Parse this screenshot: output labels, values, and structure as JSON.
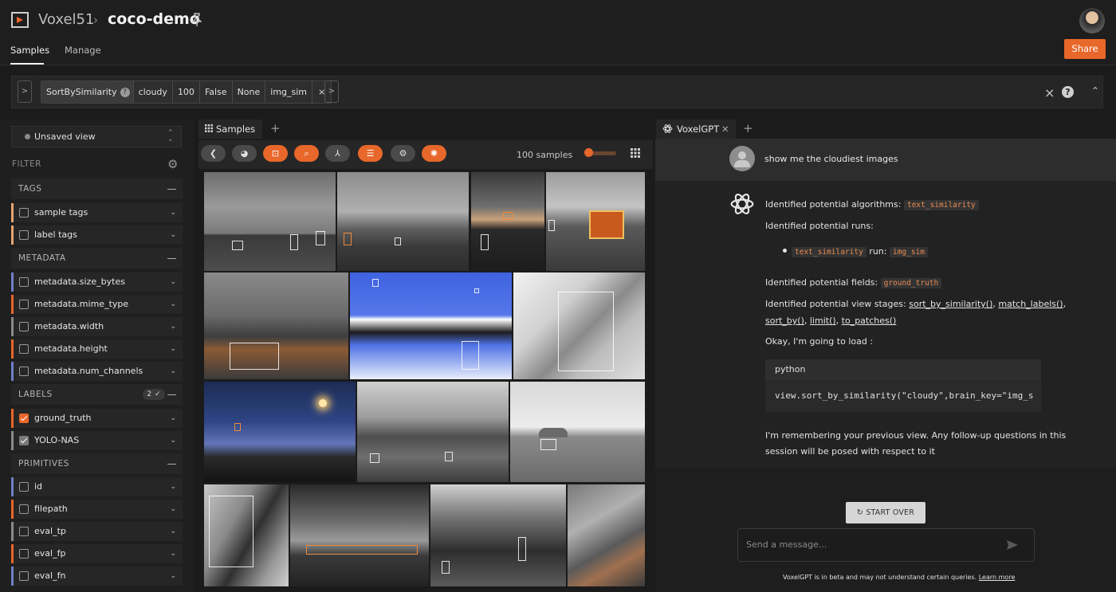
{
  "header": {
    "brand": "Voxel51",
    "separator": "›",
    "dataset": "coco-demo",
    "nav_tabs": [
      "Samples",
      "Manage"
    ],
    "share_label": "Share"
  },
  "viewbar": {
    "left_chevron": ">",
    "right_chevron": ">",
    "stage": {
      "name": "SortBySimilarity",
      "help": "?",
      "params": [
        "cloudy",
        "100",
        "False",
        "None",
        "img_sim"
      ],
      "remove": "×"
    },
    "close": "×",
    "help": "?",
    "collapse": "⌃"
  },
  "sidebar": {
    "view_selector": "Unsaved view",
    "filter_label": "FILTER",
    "groups": [
      {
        "label": "TAGS",
        "collapse": "—"
      },
      {
        "label": "METADATA",
        "collapse": "—"
      },
      {
        "label": "LABELS",
        "collapse": "—",
        "badge": "2 ✓"
      },
      {
        "label": "PRIMITIVES",
        "collapse": "—"
      }
    ],
    "fields": [
      {
        "label": "sample tags",
        "color": "#e8a572"
      },
      {
        "label": "label tags",
        "color": "#e8a572"
      },
      {
        "label": "metadata.size_bytes",
        "color": "#6f7fc9"
      },
      {
        "label": "metadata.mime_type",
        "color": "#e8672a"
      },
      {
        "label": "metadata.width",
        "color": "#8a8a8a"
      },
      {
        "label": "metadata.height",
        "color": "#e8672a"
      },
      {
        "label": "metadata.num_channels",
        "color": "#6f7fc9"
      },
      {
        "label": "ground_truth",
        "color": "#e8672a"
      },
      {
        "label": "YOLO-NAS",
        "color": "#8a8a8a"
      },
      {
        "label": "id",
        "color": "#6f7fc9"
      },
      {
        "label": "filepath",
        "color": "#e8672a"
      },
      {
        "label": "eval_tp",
        "color": "#8a8a8a"
      },
      {
        "label": "eval_fp",
        "color": "#e8672a"
      },
      {
        "label": "eval_fn",
        "color": "#6f7fc9"
      }
    ]
  },
  "samples": {
    "tab_label": "Samples",
    "add_tab": "+",
    "count": "100 samples"
  },
  "voxelgpt": {
    "tab_label": "VoxelGPT",
    "tab_close": "✕",
    "add_tab": "+",
    "user_message": "show me the cloudiest images",
    "algorithms_prefix": "Identified potential algorithms:",
    "algorithms_code": "text_similarity",
    "runs_label": "Identified potential runs:",
    "run_code": "text_similarity",
    "run_word": "run:",
    "run_value": "img_sim",
    "fields_prefix": "Identified potential fields:",
    "fields_code": "ground_truth",
    "stages_prefix": "Identified potential view stages:",
    "stage_links": [
      "sort_by_similarity()",
      "match_labels()",
      "sort_by()",
      "limit()",
      "to_patches()"
    ],
    "loading_text": "Okay, I'm going to load :",
    "code_lang": "python",
    "code_line": "view.sort_by_similarity(\"cloudy\",brain_key=\"img_s",
    "remember_line1": "I'm remembering your previous view. Any follow-up questions in this",
    "remember_line2": "session will be posed with respect to it",
    "start_over": "START OVER",
    "input_placeholder": "Send a message...",
    "disclaimer": "VoxelGPT is in beta and may not understand certain queries.",
    "learn_more": "Learn more"
  },
  "colors": {
    "accent": "#e8672a",
    "background": "#1b1b1b",
    "panel": "#262626"
  }
}
